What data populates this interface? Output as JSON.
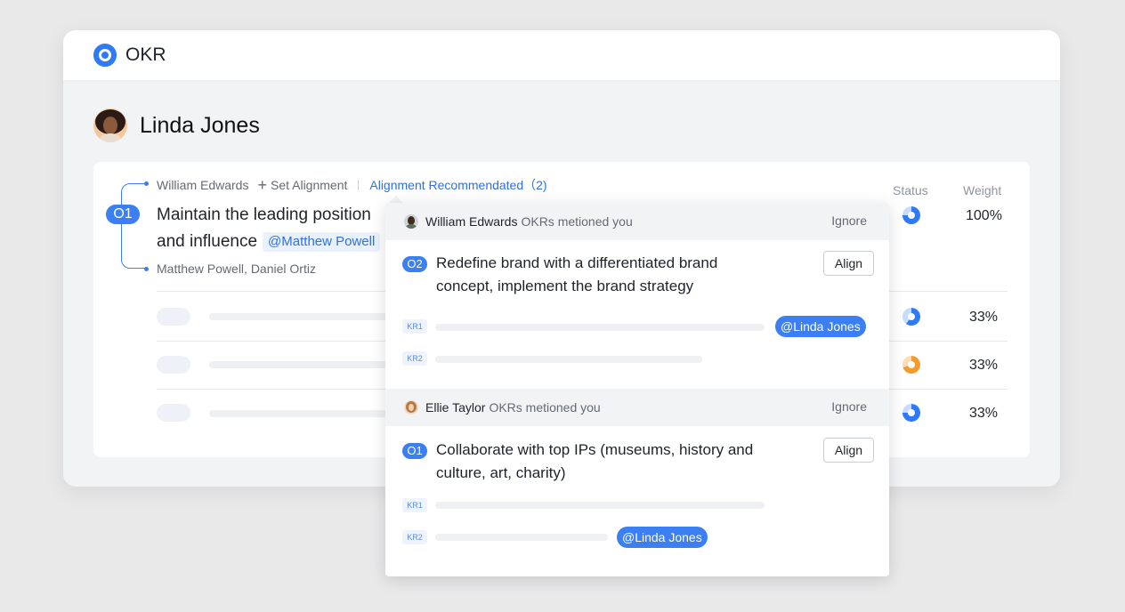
{
  "app": {
    "title": "OKR"
  },
  "user": {
    "name": "Linda Jones"
  },
  "objective": {
    "badge": "O1",
    "parent_owner": "William Edwards",
    "set_alignment": "Set Alignment",
    "alignment_recommended": "Alignment Recommendated（2)",
    "title": "Maintain the leading position and influence",
    "mention": "@Matthew Powell",
    "owners": "Matthew Powell, Daniel Ortiz"
  },
  "columns": {
    "status": "Status",
    "weight": "Weight"
  },
  "rows": [
    {
      "weight": "100%",
      "status_icon": "progress-ring-blue"
    },
    {
      "weight": "33%",
      "status_icon": "progress-ring-blue"
    },
    {
      "weight": "33%",
      "status_icon": "progress-ring-orange"
    },
    {
      "weight": "33%",
      "status_icon": "progress-ring-blue"
    }
  ],
  "popup": {
    "items": [
      {
        "user": "William Edwards",
        "action": "OKRs metioned you",
        "ignore": "Ignore",
        "badge": "O2",
        "title": "Redefine brand with a differentiated brand concept, implement the brand strategy",
        "align": "Align",
        "krs": [
          {
            "tag": "KR1",
            "mention": "@Linda Jones"
          },
          {
            "tag": "KR2",
            "mention": ""
          }
        ]
      },
      {
        "user": "Ellie Taylor",
        "action": "OKRs metioned you",
        "ignore": "Ignore",
        "badge": "O1",
        "title": "Collaborate with top IPs (museums, history and culture, art, charity)",
        "align": "Align",
        "krs": [
          {
            "tag": "KR1",
            "mention": ""
          },
          {
            "tag": "KR2",
            "mention": "@Linda Jones"
          }
        ]
      }
    ]
  },
  "colors": {
    "accent": "#3b7ff3",
    "warning": "#f29b2f",
    "background": "#e9e9ea"
  }
}
